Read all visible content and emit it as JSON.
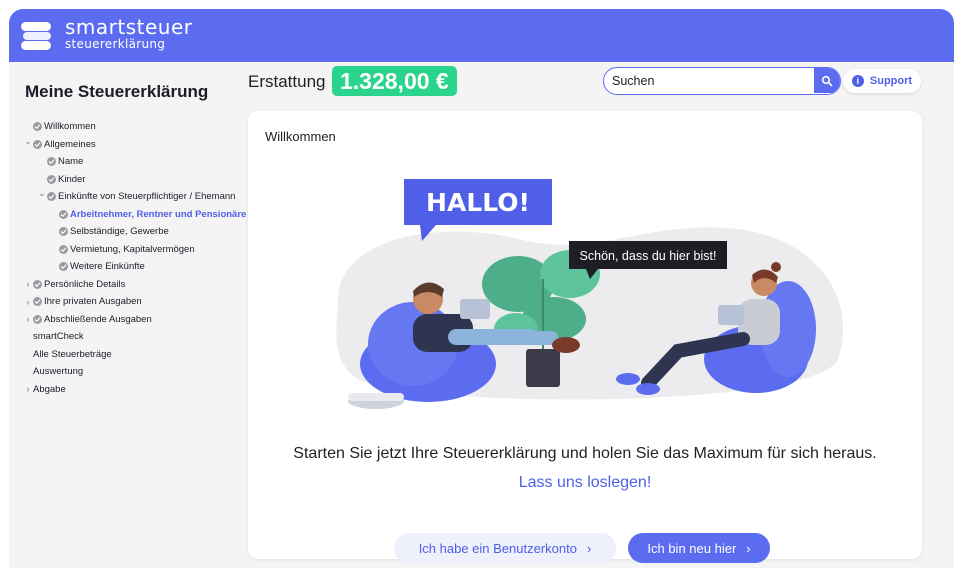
{
  "app": {
    "logo_line1": "smartsteuer",
    "logo_line2": "steuererklärung",
    "brand_color": "#5b6cf0",
    "accent_green": "#2bd48c"
  },
  "sidebar": {
    "title": "Meine Steuererklärung",
    "items": [
      {
        "label": "Willkommen",
        "chevron": "",
        "check": true
      },
      {
        "label": "Allgemeines",
        "chevron": "down",
        "check": true
      },
      {
        "label": "Name",
        "chevron": "",
        "check": true
      },
      {
        "label": "Kinder",
        "chevron": "",
        "check": true
      },
      {
        "label": "Einkünfte von Steuerpflichtiger / Ehemann",
        "chevron": "down",
        "check": true
      },
      {
        "label": "Arbeitnehmer, Rentner und Pensionäre",
        "chevron": "",
        "check": true,
        "active": true
      },
      {
        "label": "Selbständige, Gewerbe",
        "chevron": "",
        "check": true
      },
      {
        "label": "Vermietung, Kapitalvermögen",
        "chevron": "",
        "check": true
      },
      {
        "label": "Weitere Einkünfte",
        "chevron": "",
        "check": true
      },
      {
        "label": "Persönliche Details",
        "chevron": "right",
        "check": true
      },
      {
        "label": "Ihre privaten Ausgaben",
        "chevron": "right",
        "check": true
      },
      {
        "label": "Abschließende Ausgaben",
        "chevron": "right",
        "check": true
      },
      {
        "label": "smartCheck",
        "chevron": "",
        "check": false
      },
      {
        "label": "Alle Steuerbeträge",
        "chevron": "",
        "check": false
      },
      {
        "label": "Auswertung",
        "chevron": "",
        "check": false
      },
      {
        "label": "Abgabe",
        "chevron": "right",
        "check": false
      }
    ]
  },
  "header": {
    "refund_label": "Erstattung",
    "refund_amount": "1.328,00 €",
    "search_value": "Suchen",
    "support_label": "Support"
  },
  "card": {
    "title": "Willkommen",
    "bubble_hallo": "HALLO!",
    "bubble_welcome": "Schön, dass du hier bist!",
    "headline": "Starten Sie jetzt Ihre Steuererklärung und holen Sie das Maximum für sich heraus.",
    "sublink": "Lass uns loslegen!",
    "btn_account": "Ich habe ein Benutzerkonto",
    "btn_new": "Ich bin neu hier",
    "arrow": "›"
  }
}
